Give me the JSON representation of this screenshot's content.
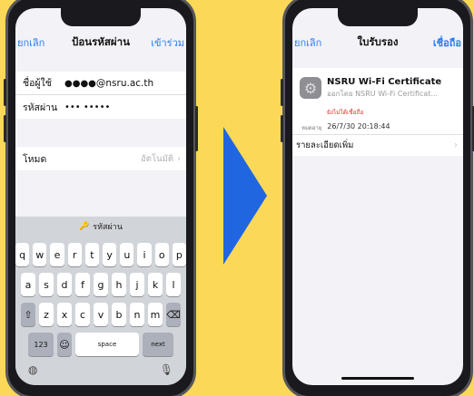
{
  "left": {
    "nav": {
      "cancel": "ยกเลิก",
      "title": "ป้อนรหัสผ่าน",
      "join": "เข้าร่วม"
    },
    "username_label": "ชื่อผู้ใช้",
    "username_dots": "●●●●",
    "username_domain": "@nsru.ac.th",
    "password_label": "รหัสผ่าน",
    "password_value": "••• •••••",
    "mode_label": "โหมด",
    "mode_value": "อัตโนมัติ",
    "keyboard": {
      "bar_label": "รหัสผ่าน",
      "row1": [
        "q",
        "w",
        "e",
        "r",
        "t",
        "y",
        "u",
        "i",
        "o",
        "p"
      ],
      "row2": [
        "a",
        "s",
        "d",
        "f",
        "g",
        "h",
        "j",
        "k",
        "l"
      ],
      "row3": [
        "z",
        "x",
        "c",
        "v",
        "b",
        "n",
        "m"
      ],
      "numbers": "123",
      "space": "space",
      "next": "next"
    }
  },
  "right": {
    "nav": {
      "cancel": "ยกเลิก",
      "title": "ใบรับรอง",
      "trust": "เชื่อถือ"
    },
    "cert_name": "NSRU Wi-Fi Certificate",
    "cert_issuer": "ออกโดย NSRU Wi-Fi Certificat...",
    "untrusted": "ยังไม่ได้เชื่อถือ",
    "expiry_label": "หมดอายุ",
    "expiry_value": "26/7/30 20:18:44",
    "more_details": "รายละเอียดเพิ่ม"
  },
  "colors": {
    "background": "#fbd858",
    "accent": "#2a7cf6",
    "arrow": "#1f66e0",
    "warning": "#e0342b"
  }
}
